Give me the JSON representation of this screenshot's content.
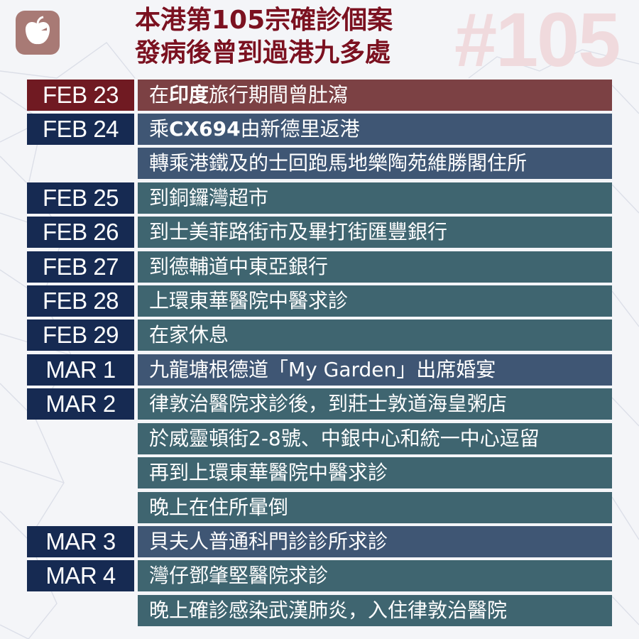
{
  "header": {
    "title_line1": "本港第105宗確診個案",
    "title_line2": "發病後曾到過港九多處",
    "watermark": "#105"
  },
  "colors": {
    "title": "#7b1120",
    "date_navy": "#162a52",
    "date_maroon": "#701a22",
    "event_maroon": "#7c4144",
    "event_slate": "#3f5674",
    "event_teal": "#3f6570"
  },
  "timeline": [
    {
      "date": "FEB 23",
      "text_pre": "在",
      "text_bold": "印度",
      "text_post": "旅行期間曾肚瀉"
    },
    {
      "date": "FEB 24",
      "text_pre": "乘",
      "text_bold": "CX694",
      "text_post": "由新德里返港"
    },
    {
      "date": "",
      "text_pre": "轉乘港鐵及的士回跑馬地樂陶苑維勝閣住所",
      "text_bold": "",
      "text_post": ""
    },
    {
      "date": "FEB 25",
      "text_pre": "到銅鑼灣超市",
      "text_bold": "",
      "text_post": ""
    },
    {
      "date": "FEB 26",
      "text_pre": "到士美菲路街市及畢打街匯豐銀行",
      "text_bold": "",
      "text_post": ""
    },
    {
      "date": "FEB 27",
      "text_pre": "到德輔道中東亞銀行",
      "text_bold": "",
      "text_post": ""
    },
    {
      "date": "FEB 28",
      "text_pre": "上環東華醫院中醫求診",
      "text_bold": "",
      "text_post": ""
    },
    {
      "date": "FEB 29",
      "text_pre": "在家休息",
      "text_bold": "",
      "text_post": ""
    },
    {
      "date": "MAR 1",
      "text_pre": "九龍塘根德道「My Garden」出席婚宴",
      "text_bold": "",
      "text_post": ""
    },
    {
      "date": "MAR 2",
      "text_pre": "律敦治醫院求診後，到莊士敦道海皇粥店",
      "text_bold": "",
      "text_post": ""
    },
    {
      "date": "",
      "text_pre": "於威靈頓街2-8號、中銀中心和統一中心逗留",
      "text_bold": "",
      "text_post": ""
    },
    {
      "date": "",
      "text_pre": "再到上環東華醫院中醫求診",
      "text_bold": "",
      "text_post": ""
    },
    {
      "date": "",
      "text_pre": "晚上在住所暈倒",
      "text_bold": "",
      "text_post": ""
    },
    {
      "date": "MAR 3",
      "text_pre": "貝夫人普通科門診診所求診",
      "text_bold": "",
      "text_post": ""
    },
    {
      "date": "MAR 4",
      "text_pre": "灣仔鄧肇堅醫院求診",
      "text_bold": "",
      "text_post": ""
    },
    {
      "date": "",
      "text_pre": "晚上確診感染武漢肺炎，入住律敦治醫院",
      "text_bold": "",
      "text_post": ""
    }
  ]
}
